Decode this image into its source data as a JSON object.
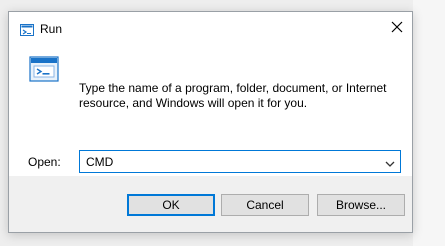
{
  "window": {
    "title": "Run",
    "icons": {
      "app": "run-icon",
      "close": "close-icon",
      "content": "run-icon-large",
      "combo_arrow": "chevron-down-icon"
    }
  },
  "content": {
    "description": "Type the name of a program, folder, document, or Internet resource, and Windows will open it for you.",
    "open_label": "Open:",
    "open_value": "CMD"
  },
  "buttons": {
    "ok": "OK",
    "cancel": "Cancel",
    "browse": "Browse..."
  },
  "colors": {
    "accent": "#0078d7",
    "window_bg": "#ffffff",
    "footer_bg": "#f0f0f0",
    "button_bg": "#e1e1e1",
    "border": "#adadad"
  }
}
